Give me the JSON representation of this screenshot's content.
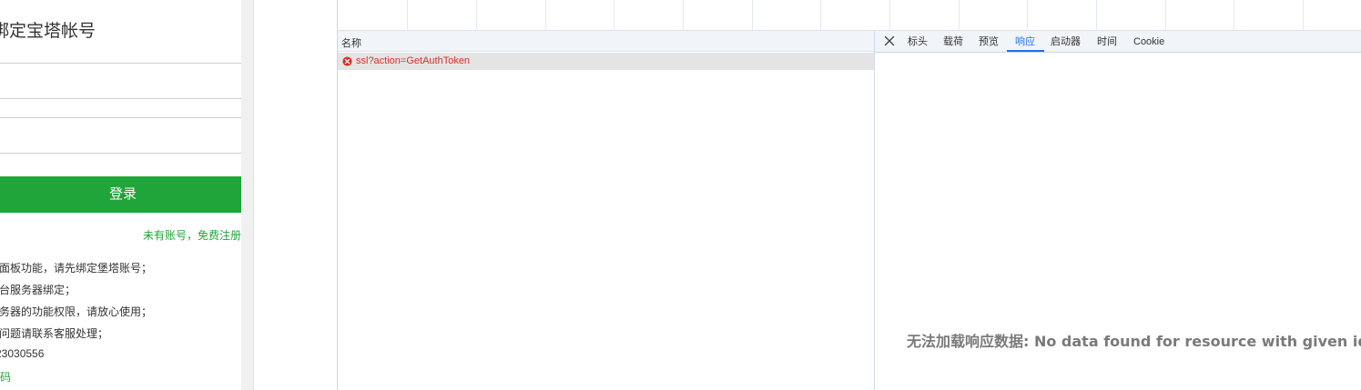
{
  "login": {
    "title": "绑定宝塔帐号",
    "username_placeholder": "",
    "password_placeholder": "",
    "login_button": "登录",
    "register_link": "未有账号，免费注册",
    "tips": [
      "验面板功能，请先绑定堡塔账号；",
      "多台服务器绑定；",
      "服务器的功能权限，请放心使用；",
      "到问题请联系客服处理；",
      "23030556",
      "维码"
    ]
  },
  "network": {
    "name_column": "名称",
    "requests": [
      {
        "name": "ssl?action=GetAuthToken",
        "status": "error",
        "status_icon": "error-circle-icon"
      }
    ],
    "detail_tabs": {
      "close": "close-icon",
      "headers": "标头",
      "payload": "载荷",
      "preview": "预览",
      "response": "响应",
      "initiator": "启动器",
      "timing": "时间",
      "cookies": "Cookie"
    },
    "active_tab": "响应",
    "response_message": "无法加载响应数据: No data found for resource with given identifie"
  },
  "colors": {
    "brand_green": "#20a53a",
    "error_red": "#d93025",
    "active_tab_blue": "#1a73e8"
  }
}
